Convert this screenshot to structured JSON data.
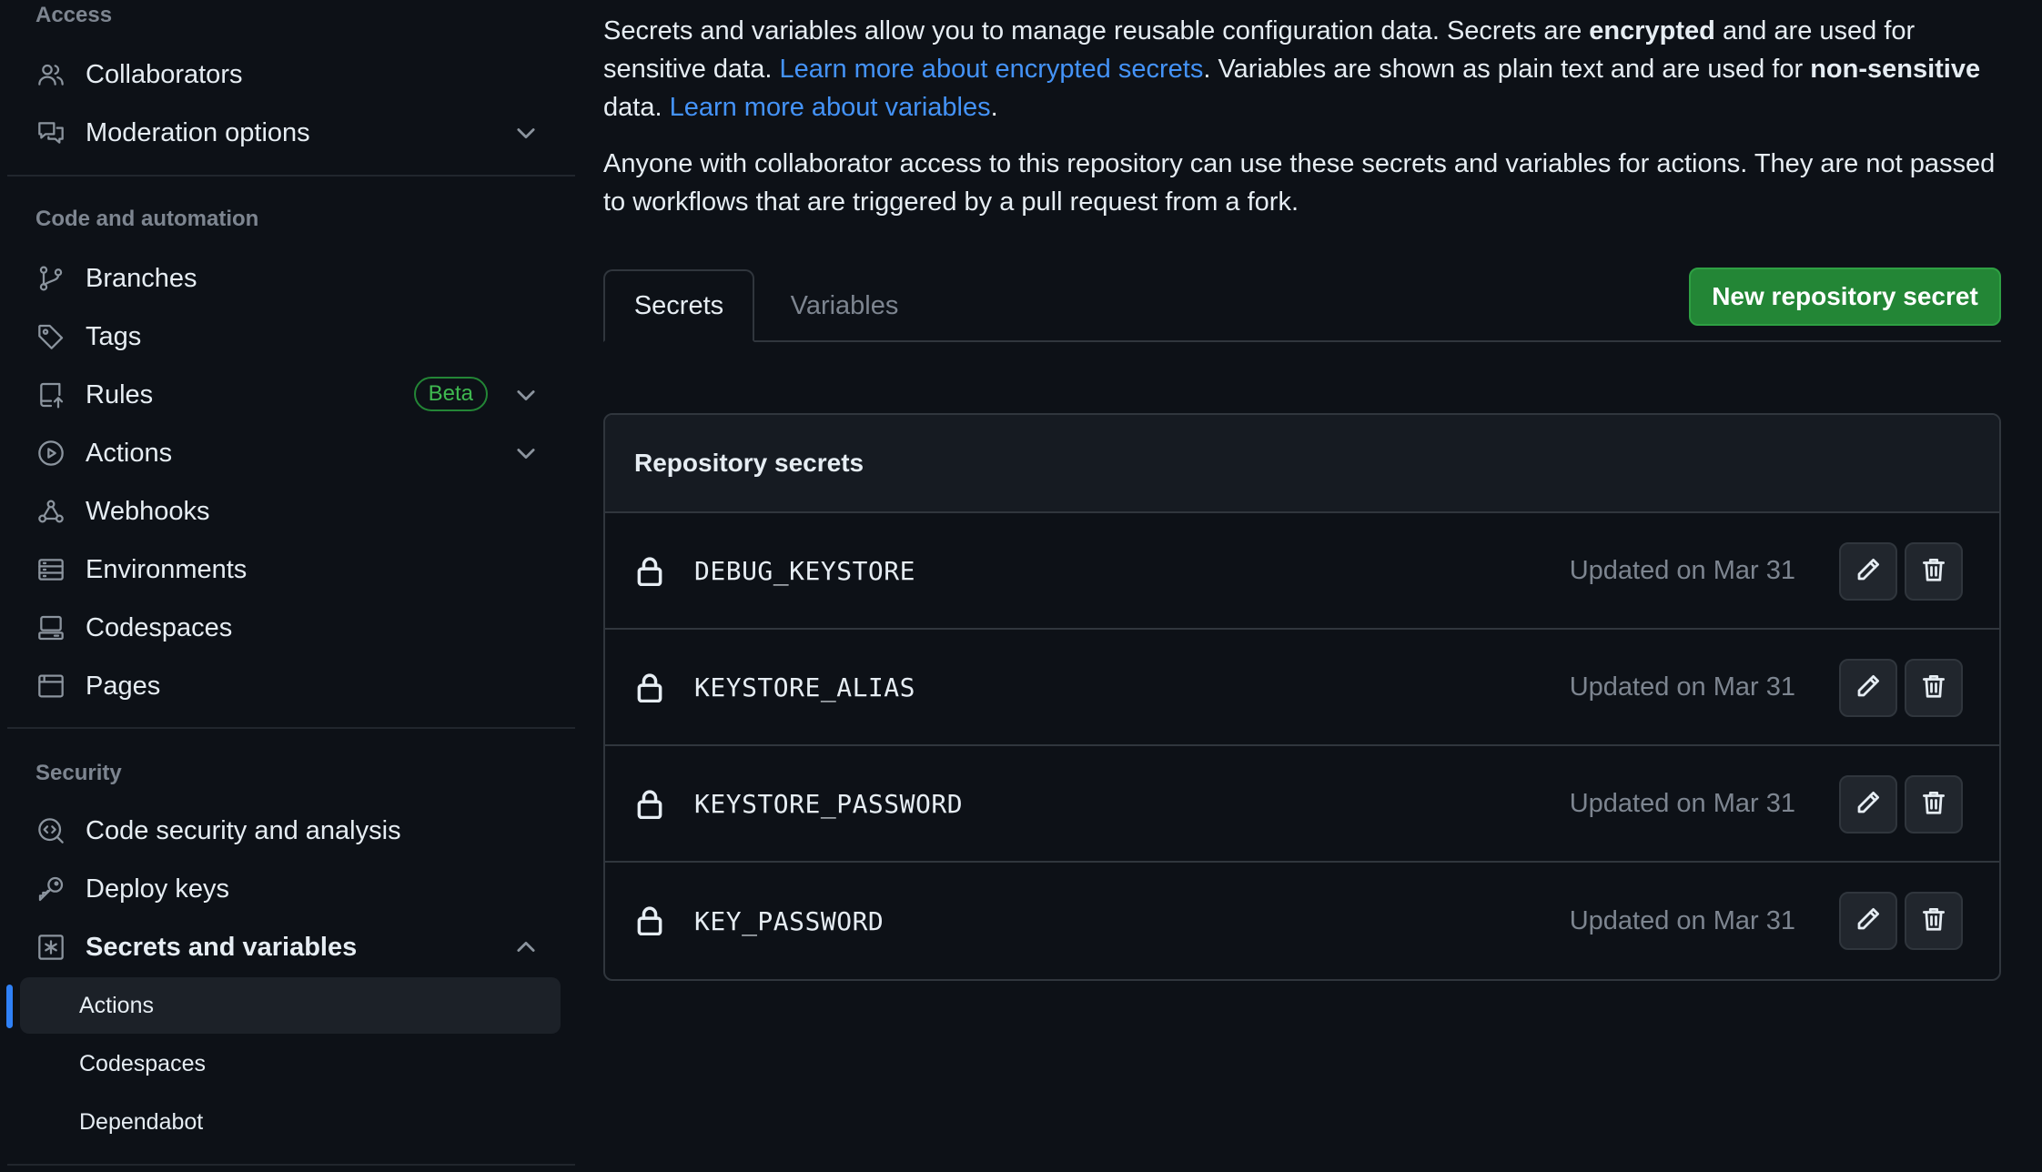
{
  "sidebar": {
    "access": {
      "heading": "Access",
      "items": [
        {
          "label": "Collaborators",
          "icon": "people-icon"
        },
        {
          "label": "Moderation options",
          "icon": "comment-discussion-icon"
        }
      ]
    },
    "code_automation": {
      "heading": "Code and automation",
      "items": [
        {
          "label": "Branches",
          "icon": "git-branch-icon"
        },
        {
          "label": "Tags",
          "icon": "tag-icon"
        },
        {
          "label": "Rules",
          "icon": "repo-push-icon",
          "badge": "Beta"
        },
        {
          "label": "Actions",
          "icon": "play-icon"
        },
        {
          "label": "Webhooks",
          "icon": "webhook-icon"
        },
        {
          "label": "Environments",
          "icon": "server-icon"
        },
        {
          "label": "Codespaces",
          "icon": "codespaces-icon"
        },
        {
          "label": "Pages",
          "icon": "browser-icon"
        }
      ]
    },
    "security": {
      "heading": "Security",
      "items": [
        {
          "label": "Code security and analysis",
          "icon": "codescan-icon"
        },
        {
          "label": "Deploy keys",
          "icon": "key-icon"
        },
        {
          "label": "Secrets and variables",
          "icon": "key-asterisk-icon"
        }
      ],
      "subitems": [
        {
          "label": "Actions",
          "active": true
        },
        {
          "label": "Codespaces",
          "active": false
        },
        {
          "label": "Dependabot",
          "active": false
        }
      ]
    }
  },
  "main": {
    "intro": {
      "t1": "Secrets and variables allow you to manage reusable configuration data. Secrets are ",
      "b1": "encrypted",
      "t2": " and are used for sensitive data. ",
      "link1": "Learn more about encrypted secrets",
      "t3": ". Variables are shown as plain text and are used for ",
      "b2": "non-sensitive",
      "t4": " data. ",
      "link2": "Learn more about variables",
      "t5": "."
    },
    "access_note": "Anyone with collaborator access to this repository can use these secrets and variables for actions. They are not passed to workflows that are triggered by a pull request from a fork.",
    "tabs": [
      {
        "label": "Secrets",
        "selected": true
      },
      {
        "label": "Variables",
        "selected": false
      }
    ],
    "new_secret_button": "New repository secret",
    "secrets_box": {
      "title": "Repository secrets",
      "rows": [
        {
          "name": "DEBUG_KEYSTORE",
          "updated": "Updated on Mar 31"
        },
        {
          "name": "KEYSTORE_ALIAS",
          "updated": "Updated on Mar 31"
        },
        {
          "name": "KEYSTORE_PASSWORD",
          "updated": "Updated on Mar 31"
        },
        {
          "name": "KEY_PASSWORD",
          "updated": "Updated on Mar 31"
        }
      ]
    }
  },
  "colors": {
    "background": "#0d1117",
    "accent_link": "#4493f8",
    "primary_button": "#238636",
    "active_indicator": "#2f81f7",
    "muted_text": "#7d8590"
  }
}
